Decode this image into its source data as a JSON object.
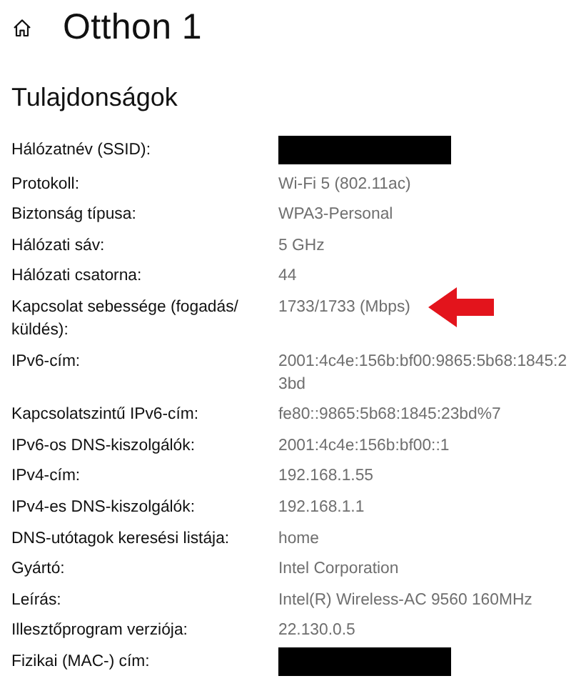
{
  "header": {
    "title": "Otthon 1"
  },
  "section": {
    "heading": "Tulajdonságok"
  },
  "properties": [
    {
      "label": "Hálózatnév (SSID):",
      "kind": "redacted",
      "arrow": false
    },
    {
      "label": "Protokoll:",
      "kind": "text",
      "value": "Wi-Fi 5 (802.11ac)",
      "arrow": false
    },
    {
      "label": "Biztonság típusa:",
      "kind": "text",
      "value": "WPA3-Personal",
      "arrow": false
    },
    {
      "label": "Hálózati sáv:",
      "kind": "text",
      "value": "5 GHz",
      "arrow": false
    },
    {
      "label": "Hálózati csatorna:",
      "kind": "text",
      "value": "44",
      "arrow": false
    },
    {
      "label": "Kapcsolat sebessége (fogadás/ küldés):",
      "kind": "text",
      "value": "1733/1733 (Mbps)",
      "arrow": true
    },
    {
      "label": "IPv6-cím:",
      "kind": "text",
      "value": "2001:4c4e:156b:bf00:9865:5b68:1845:23bd",
      "arrow": false
    },
    {
      "label": "Kapcsolatszintű IPv6-cím:",
      "kind": "text",
      "value": "fe80::9865:5b68:1845:23bd%7",
      "arrow": false
    },
    {
      "label": "IPv6-os DNS-kiszolgálók:",
      "kind": "text",
      "value": "2001:4c4e:156b:bf00::1",
      "arrow": false
    },
    {
      "label": "IPv4-cím:",
      "kind": "text",
      "value": "192.168.1.55",
      "arrow": false
    },
    {
      "label": "IPv4-es DNS-kiszolgálók:",
      "kind": "text",
      "value": "192.168.1.1",
      "arrow": false
    },
    {
      "label": "DNS-utótagok keresési listája:",
      "kind": "text",
      "value": "home",
      "arrow": false
    },
    {
      "label": "Gyártó:",
      "kind": "text",
      "value": "Intel Corporation",
      "arrow": false
    },
    {
      "label": "Leírás:",
      "kind": "text",
      "value": "Intel(R) Wireless-AC 9560 160MHz",
      "arrow": false
    },
    {
      "label": "Illesztőprogram verziója:",
      "kind": "text",
      "value": "22.130.0.5",
      "arrow": false
    },
    {
      "label": "Fizikai (MAC-) cím:",
      "kind": "redacted",
      "arrow": false
    }
  ]
}
